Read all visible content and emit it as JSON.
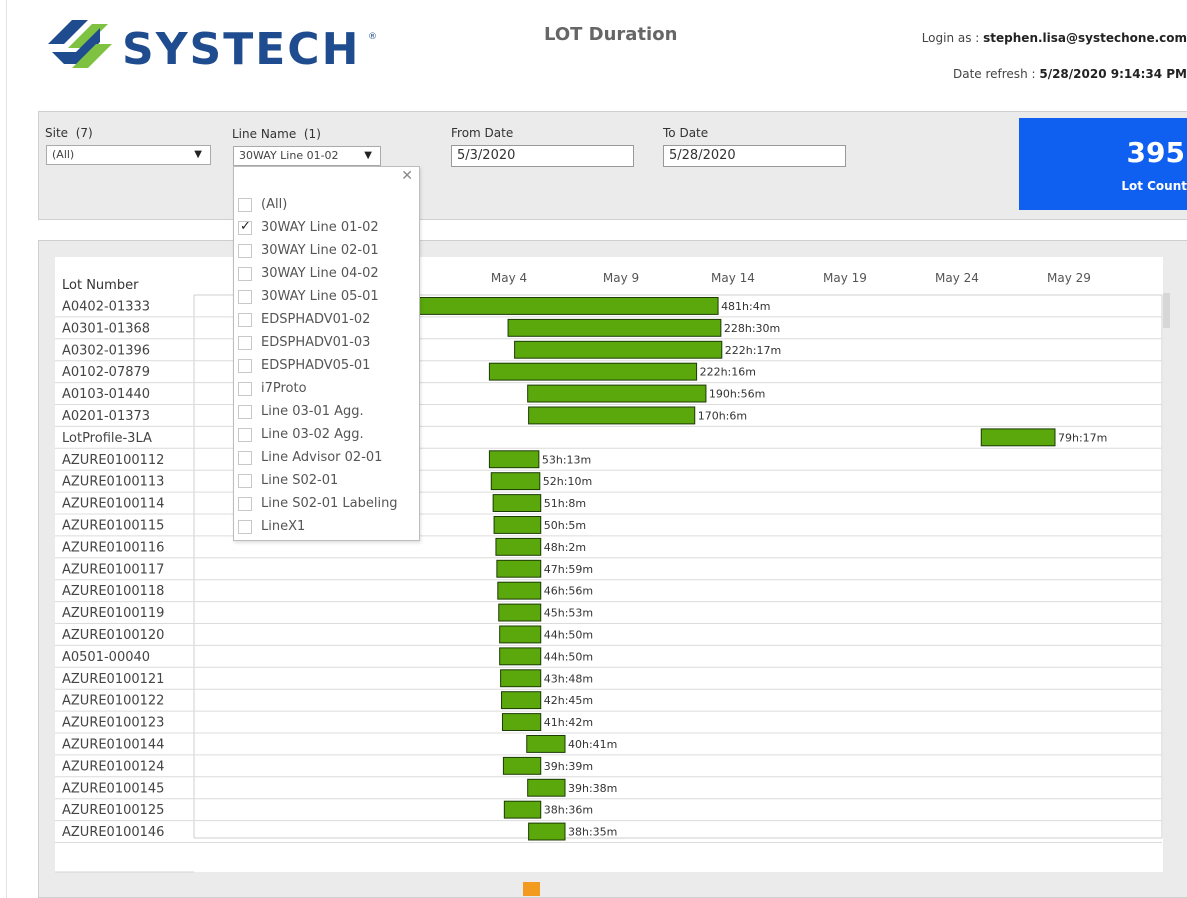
{
  "header": {
    "brand": "SYSTECH",
    "title": "LOT Duration",
    "login_prefix": "Login as : ",
    "login_user": "stephen.lisa@systechone.com",
    "refresh_prefix": "Date refresh : ",
    "refresh_value": "5/28/2020 9:14:34 PM"
  },
  "filters": {
    "site": {
      "label": "Site",
      "count": "(7)",
      "value": "(All)"
    },
    "line_name": {
      "label": "Line Name",
      "count": "(1)",
      "value": "30WAY Line 01-02"
    },
    "from_date": {
      "label": "From Date",
      "value": "5/3/2020"
    },
    "to_date": {
      "label": "To Date",
      "value": "5/28/2020"
    }
  },
  "kpi": {
    "value": "395",
    "label": "Lot Count"
  },
  "dropdown": {
    "items": [
      {
        "label": "(All)",
        "checked": false
      },
      {
        "label": "30WAY Line 01-02",
        "checked": true
      },
      {
        "label": "30WAY Line 02-01",
        "checked": false
      },
      {
        "label": "30WAY Line 04-02",
        "checked": false
      },
      {
        "label": "30WAY Line 05-01",
        "checked": false
      },
      {
        "label": "EDSPHADV01-02",
        "checked": false
      },
      {
        "label": "EDSPHADV01-03",
        "checked": false
      },
      {
        "label": "EDSPHADV05-01",
        "checked": false
      },
      {
        "label": "i7Proto",
        "checked": false
      },
      {
        "label": "Line 03-01 Agg.",
        "checked": false
      },
      {
        "label": "Line 03-02 Agg.",
        "checked": false
      },
      {
        "label": "Line Advisor 02-01",
        "checked": false
      },
      {
        "label": "Line S02-01",
        "checked": false
      },
      {
        "label": "Line S02-01 Labeling",
        "checked": false
      },
      {
        "label": "LineX1",
        "checked": false
      }
    ]
  },
  "colors": {
    "bar": "#5aa80c",
    "bar_border": "#1c3a05",
    "kpi_bg": "#0f5ff0",
    "handle": "#f29b1f"
  },
  "chart_data": {
    "type": "bar",
    "orientation": "horizontal-gantt",
    "row_header": "Lot Number",
    "x_ticks": [
      "May 4",
      "May 9",
      "May 14",
      "May 19",
      "May 24",
      "May 29"
    ],
    "rows": [
      {
        "lot": "A0402-01333",
        "start": "2020-04-23 09:00",
        "end": "2020-05-13 08:00",
        "label": "481h:4m"
      },
      {
        "lot": "A0301-01368",
        "start": "2020-05-03 23:00",
        "end": "2020-05-13 11:00",
        "label": "228h:30m"
      },
      {
        "lot": "A0302-01396",
        "start": "2020-05-04 06:00",
        "end": "2020-05-13 12:00",
        "label": "222h:17m"
      },
      {
        "lot": "A0102-07879",
        "start": "2020-05-03 03:00",
        "end": "2020-05-12 09:00",
        "label": "222h:16m"
      },
      {
        "lot": "A0103-01440",
        "start": "2020-05-04 20:00",
        "end": "2020-05-12 19:00",
        "label": "190h:56m"
      },
      {
        "lot": "A0201-01373",
        "start": "2020-05-04 21:00",
        "end": "2020-05-12 07:00",
        "label": "170h:6m"
      },
      {
        "lot": "LotProfile-3LA",
        "start": "2020-05-25 02:00",
        "end": "2020-05-28 09:00",
        "label": "79h:17m"
      },
      {
        "lot": "AZURE0100112",
        "start": "2020-05-03 03:00",
        "end": "2020-05-05 08:00",
        "label": "53h:13m"
      },
      {
        "lot": "AZURE0100113",
        "start": "2020-05-03 05:00",
        "end": "2020-05-05 09:00",
        "label": "52h:10m"
      },
      {
        "lot": "AZURE0100114",
        "start": "2020-05-03 07:00",
        "end": "2020-05-05 10:00",
        "label": "51h:8m"
      },
      {
        "lot": "AZURE0100115",
        "start": "2020-05-03 08:00",
        "end": "2020-05-05 10:00",
        "label": "50h:5m"
      },
      {
        "lot": "AZURE0100116",
        "start": "2020-05-03 10:00",
        "end": "2020-05-05 10:00",
        "label": "48h:2m"
      },
      {
        "lot": "AZURE0100117",
        "start": "2020-05-03 11:00",
        "end": "2020-05-05 10:00",
        "label": "47h:59m"
      },
      {
        "lot": "AZURE0100118",
        "start": "2020-05-03 12:00",
        "end": "2020-05-05 10:00",
        "label": "46h:56m"
      },
      {
        "lot": "AZURE0100119",
        "start": "2020-05-03 13:00",
        "end": "2020-05-05 10:00",
        "label": "45h:53m"
      },
      {
        "lot": "AZURE0100120",
        "start": "2020-05-03 14:00",
        "end": "2020-05-05 10:00",
        "label": "44h:50m"
      },
      {
        "lot": "A0501-00040",
        "start": "2020-05-03 14:00",
        "end": "2020-05-05 10:00",
        "label": "44h:50m"
      },
      {
        "lot": "AZURE0100121",
        "start": "2020-05-03 15:00",
        "end": "2020-05-05 10:00",
        "label": "43h:48m"
      },
      {
        "lot": "AZURE0100122",
        "start": "2020-05-03 16:00",
        "end": "2020-05-05 10:00",
        "label": "42h:45m"
      },
      {
        "lot": "AZURE0100123",
        "start": "2020-05-03 17:00",
        "end": "2020-05-05 10:00",
        "label": "41h:42m"
      },
      {
        "lot": "AZURE0100144",
        "start": "2020-05-04 19:00",
        "end": "2020-05-06 12:00",
        "label": "40h:41m"
      },
      {
        "lot": "AZURE0100124",
        "start": "2020-05-03 18:00",
        "end": "2020-05-05 10:00",
        "label": "39h:39m"
      },
      {
        "lot": "AZURE0100145",
        "start": "2020-05-04 20:00",
        "end": "2020-05-06 12:00",
        "label": "39h:38m"
      },
      {
        "lot": "AZURE0100125",
        "start": "2020-05-03 19:00",
        "end": "2020-05-05 10:00",
        "label": "38h:36m"
      },
      {
        "lot": "AZURE0100146",
        "start": "2020-05-04 21:00",
        "end": "2020-05-06 12:00",
        "label": "38h:35m"
      }
    ]
  }
}
